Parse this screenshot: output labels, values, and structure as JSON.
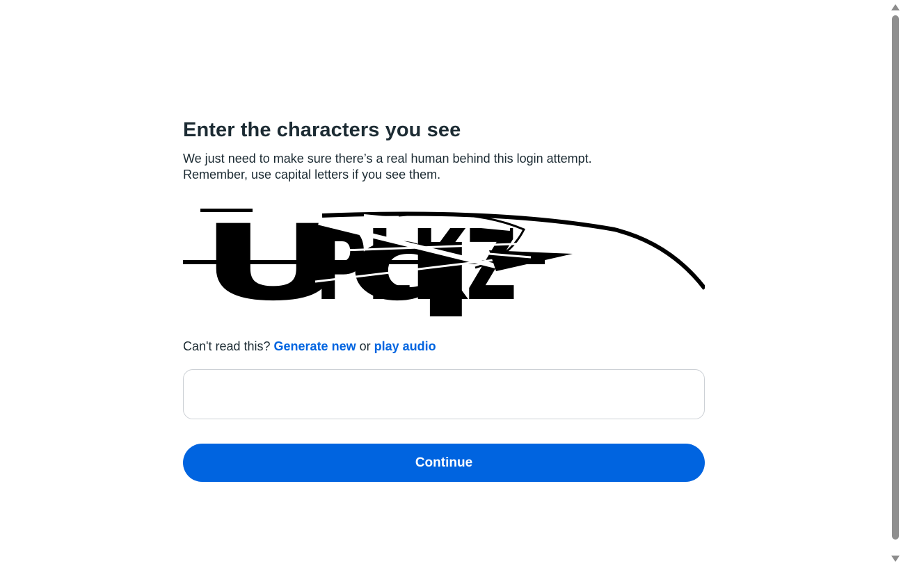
{
  "page": {
    "title": "Enter the characters you see",
    "description_lines": [
      "We just need to make sure there’s a real human behind this login attempt.",
      "Remember, use capital letters if you see them."
    ]
  },
  "captcha": {
    "image_text": "UqPLKZ",
    "refresh_prompt": "Can't read this?",
    "generate_new_label": "Generate new",
    "or_text": "or",
    "play_audio_label": "play audio"
  },
  "input": {
    "value": "",
    "placeholder": ""
  },
  "actions": {
    "continue_label": "Continue"
  },
  "colors": {
    "primary": "#0064e0",
    "text": "#1c2b33",
    "border": "#ccd0d5"
  }
}
